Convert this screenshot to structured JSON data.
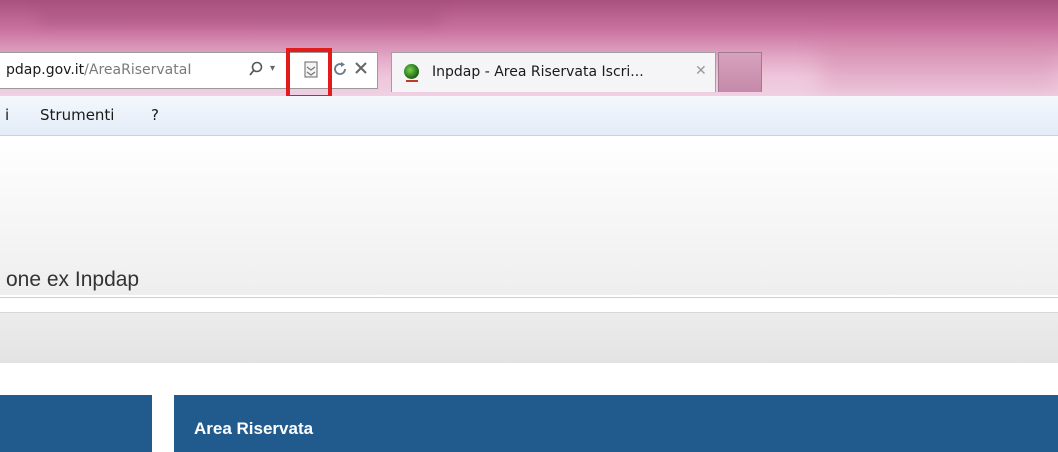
{
  "browser": {
    "address": {
      "host": "pdap.gov.it",
      "path": "/AreaRiservataI"
    },
    "tab": {
      "title": "Inpdap - Area Riservata Iscri..."
    },
    "menu": {
      "items": [
        "i",
        "Strumenti",
        "?"
      ]
    }
  },
  "page": {
    "header_title": "one ex Inpdap",
    "area_title": "Area Riservata"
  },
  "colors": {
    "highlight": "#e21b1b",
    "brand_blue": "#215b8e"
  }
}
